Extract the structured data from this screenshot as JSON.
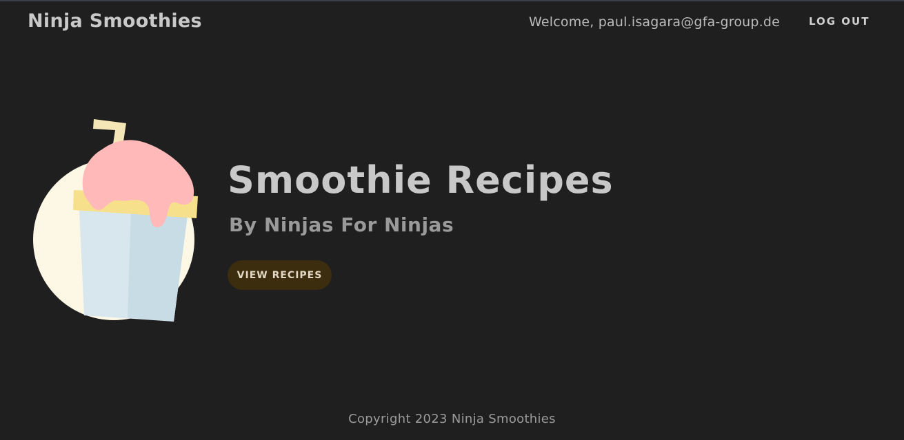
{
  "header": {
    "brand": "Ninja Smoothies",
    "welcome": "Welcome, paul.isagara@gfa-group.de",
    "logout_label": "LOG OUT"
  },
  "hero": {
    "illustration_icon": "smoothie-cup-icon",
    "title": "Smoothie Recipes",
    "subtitle": "By Ninjas For Ninjas",
    "cta_label": "VIEW RECIPES"
  },
  "footer": {
    "copyright": "Copyright 2023 Ninja Smoothies"
  },
  "colors": {
    "background": "#1f1f1f",
    "brand_text": "#c9c9c9",
    "button_bg": "#3b2d0e",
    "circle": "#fdf8e6",
    "cup": "#d8e6ee",
    "cup_shade": "#c7dce5",
    "rim": "#f6e08c",
    "smoothie": "#ffb9b9",
    "straw": "#f5e6b8"
  }
}
